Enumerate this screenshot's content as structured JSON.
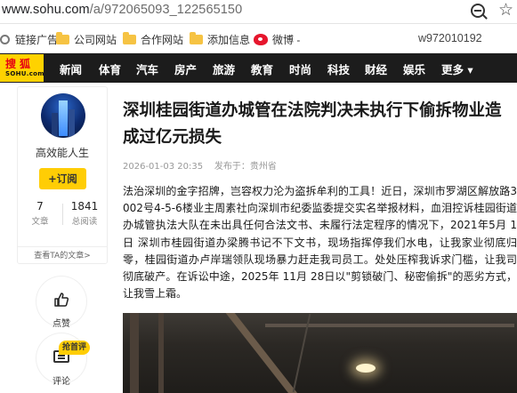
{
  "browser": {
    "url_host": "www.sohu.com",
    "url_path": "/a/972065093_122565150"
  },
  "bookmarks": {
    "items": [
      {
        "label": "链接广告",
        "icon": "link-icon"
      },
      {
        "label": "公司网站",
        "icon": "folder-icon"
      },
      {
        "label": "合作网站",
        "icon": "folder-icon"
      },
      {
        "label": "添加信息",
        "icon": "folder-icon"
      },
      {
        "label": "微博 -",
        "icon": "weibo-icon"
      }
    ],
    "account": "w972010192"
  },
  "nav": {
    "logo_cn": "搜狐",
    "logo_en": "SOHU.com",
    "items": [
      "新闻",
      "体育",
      "汽车",
      "房产",
      "旅游",
      "教育",
      "时尚",
      "科技",
      "财经",
      "娱乐"
    ],
    "more": "更多 ▾"
  },
  "author": {
    "name": "高效能人生",
    "follow_label": "+订阅",
    "articles_count": "7",
    "articles_label": "文章",
    "reads_count": "1841",
    "reads_label": "总阅读",
    "more_link": "查看TA的文章>"
  },
  "actions": {
    "like_label": "点赞",
    "comment_label": "评论",
    "hot_badge": "抢首评"
  },
  "article": {
    "title": "深圳桂园街道办城管在法院判决未执行下偷拆物业造成过亿元损失",
    "date": "2026-01-03 20:35",
    "source": "发布于：贵州省",
    "body": "法治深圳的金字招牌，岂容权力沦为盗拆牟利的工具！近日，深圳市罗湖区解放路3002号4-5-6楼业主周素社向深圳市纪委监委提交实名举报材料，血泪控诉桂园街道办城管执法大队在未出具任何合法文书、未履行法定程序的情况下，2021年5月 1日 深圳市桂园街道办梁腾书记不下文书，现场指挥停我们水电，让我家业彻底归零，桂园街道办卢岸瑞领队现场暴力赶走我司员工。处处压榨我诉求门槛，让我司彻底破产。在诉讼中途，2025年 11月 28日以\"剪锁破门、秘密偷拆\"的恶劣方式，让我雪上霜。"
  },
  "colors": {
    "nav_bg": "#1c1c1c",
    "logo_yellow": "#ffd200",
    "logo_red": "#e60012",
    "follow_yellow": "#ffcd05"
  }
}
